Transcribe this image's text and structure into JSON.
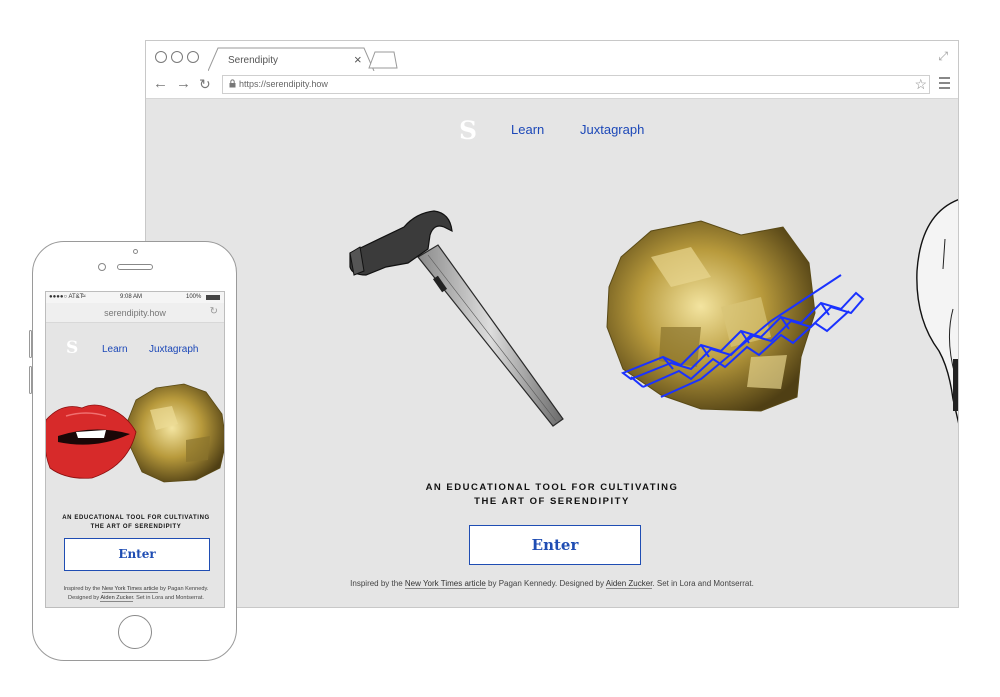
{
  "browser": {
    "tab_title": "Serendipity",
    "tab_close": "×",
    "url": "https://serendipity.how"
  },
  "site": {
    "logo": "S",
    "nav": [
      "Learn",
      "Juxtagraph"
    ],
    "tagline_line1": "AN EDUCATIONAL TOOL FOR CULTIVATING",
    "tagline_line2": "THE ART OF SERENDIPITY",
    "enter_label": "Enter",
    "credits": {
      "p1": "Inspired by the ",
      "link1": "New York Times article",
      "p2": " by Pagan Kennedy. Designed by ",
      "link2": "Aiden Zucker",
      "p3": ". Set in Lora and Montserrat."
    },
    "mobile_credits": {
      "line1_a": "Inspired by the ",
      "line1_link": "New York Times article",
      "line1_b": " by Pagan Kennedy.",
      "line2_a": "Designed by ",
      "line2_link": "Aiden Zucker",
      "line2_b": ". Set in Lora and Montserrat."
    }
  },
  "phone": {
    "carrier": "●●●●○ AT&T",
    "time": "9:08 AM",
    "battery": "100%",
    "url": "serendipity.how"
  }
}
